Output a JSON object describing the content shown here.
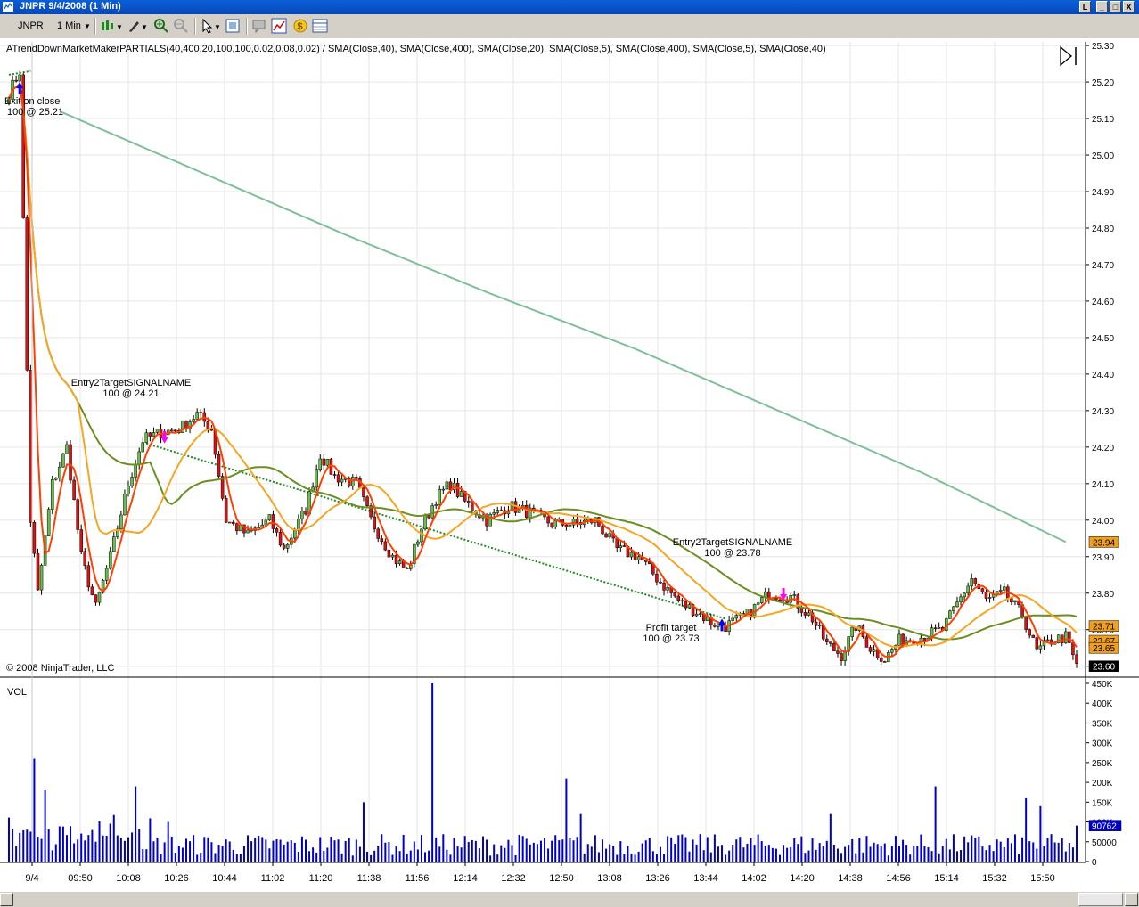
{
  "window": {
    "title": "JNPR  9/4/2008 (1 Min)",
    "buttons": [
      "L",
      "_",
      "□",
      "X"
    ]
  },
  "toolbar": {
    "instrument": "JNPR",
    "interval": "1 Min",
    "icons": [
      "candlestick-icon",
      "draw-tool-icon",
      "zoom-in-icon",
      "zoom-out-icon",
      "pointer-icon",
      "properties-icon",
      "chat-icon",
      "chart-icon",
      "dollar-icon",
      "data-box-icon"
    ]
  },
  "chart": {
    "indicator_header": "ATrendDownMarketMakerPARTIALS(40,400,20,100,100,0.02,0.08,0.02) / SMA(Close,40), SMA(Close,400), SMA(Close,20), SMA(Close,5), SMA(Close,400), SMA(Close,5), SMA(Close,40)",
    "copyright": "© 2008 NinjaTrader, LLC",
    "volume_label": "VOL",
    "price_ticks": [
      "25.30",
      "25.20",
      "25.10",
      "25.00",
      "24.90",
      "24.80",
      "24.70",
      "24.60",
      "24.50",
      "24.40",
      "24.30",
      "24.20",
      "24.10",
      "24.00",
      "23.90",
      "23.80",
      "23.70",
      "23.60"
    ],
    "volume_ticks": [
      "450K",
      "400K",
      "350K",
      "300K",
      "250K",
      "200K",
      "150K",
      "100K",
      "50000",
      "0"
    ],
    "time_ticks": [
      "9/4",
      "09:50",
      "10:08",
      "10:26",
      "10:44",
      "11:02",
      "11:20",
      "11:38",
      "11:56",
      "12:14",
      "12:32",
      "12:50",
      "13:08",
      "13:26",
      "13:44",
      "14:02",
      "14:20",
      "14:38",
      "14:56",
      "15:14",
      "15:32",
      "15:50"
    ],
    "price_flags": [
      {
        "label": "23.94",
        "value": 23.94,
        "color": "#f0a020"
      },
      {
        "label": "23.71",
        "value": 23.71,
        "color": "#f0a020"
      },
      {
        "label": "23.67",
        "value": 23.67,
        "color": "#f0a020"
      },
      {
        "label": "23.65",
        "value": 23.65,
        "color": "#f0a020"
      },
      {
        "label": "23.60",
        "value": 23.6,
        "color": "#000000"
      }
    ],
    "volume_flag": {
      "label": "90762",
      "value": 90762
    },
    "signals": [
      {
        "line1": "Exit on close",
        "line2": "100 @ 25.21",
        "arrow": "up",
        "color": "#0000ff"
      },
      {
        "line1": "Entry2TargetSIGNALNAME",
        "line2": "100 @ 24.21",
        "arrow": "down",
        "color": "#ff00ff"
      },
      {
        "line1": "Profit target",
        "line2": "100 @ 23.73",
        "arrow": "up",
        "color": "#0000ff"
      },
      {
        "line1": "Entry2TargetSIGNALNAME",
        "line2": "100 @ 23.78",
        "arrow": "down",
        "color": "#ff00ff"
      }
    ],
    "colors": {
      "up_candle": "#6abf4b",
      "down_candle": "#e01010",
      "sma5": "#ff4000",
      "sma20": "#f5a623",
      "sma40": "#6b8e23",
      "sma400": "#7fbf9a",
      "stop_dots": "#228b22",
      "volume": "#0000cc"
    }
  },
  "chart_data": {
    "type": "candlestick",
    "symbol": "JNPR",
    "interval": "1 Min",
    "date": "9/4/2008",
    "ylim": [
      23.57,
      25.31
    ],
    "volume_ylim": [
      0,
      450000
    ],
    "anchors": [
      {
        "t": 0,
        "p": 25.17
      },
      {
        "t": 3,
        "p": 25.23
      },
      {
        "t": 6,
        "p": 24.0
      },
      {
        "t": 8,
        "p": 23.8
      },
      {
        "t": 12,
        "p": 24.1
      },
      {
        "t": 16,
        "p": 24.2
      },
      {
        "t": 20,
        "p": 23.9
      },
      {
        "t": 24,
        "p": 23.76
      },
      {
        "t": 28,
        "p": 23.9
      },
      {
        "t": 33,
        "p": 24.1
      },
      {
        "t": 37,
        "p": 24.22
      },
      {
        "t": 42,
        "p": 24.24
      },
      {
        "t": 47,
        "p": 24.25
      },
      {
        "t": 52,
        "p": 24.29
      },
      {
        "t": 56,
        "p": 24.25
      },
      {
        "t": 60,
        "p": 24.0
      },
      {
        "t": 66,
        "p": 23.96
      },
      {
        "t": 72,
        "p": 24.0
      },
      {
        "t": 76,
        "p": 23.92
      },
      {
        "t": 82,
        "p": 24.03
      },
      {
        "t": 86,
        "p": 24.18
      },
      {
        "t": 90,
        "p": 24.12
      },
      {
        "t": 96,
        "p": 24.1
      },
      {
        "t": 100,
        "p": 24.0
      },
      {
        "t": 106,
        "p": 23.9
      },
      {
        "t": 110,
        "p": 23.86
      },
      {
        "t": 114,
        "p": 23.98
      },
      {
        "t": 118,
        "p": 24.06
      },
      {
        "t": 122,
        "p": 24.1
      },
      {
        "t": 126,
        "p": 24.05
      },
      {
        "t": 132,
        "p": 24.0
      },
      {
        "t": 138,
        "p": 24.04
      },
      {
        "t": 144,
        "p": 24.02
      },
      {
        "t": 150,
        "p": 23.99
      },
      {
        "t": 156,
        "p": 23.99
      },
      {
        "t": 162,
        "p": 24.0
      },
      {
        "t": 168,
        "p": 23.92
      },
      {
        "t": 174,
        "p": 23.9
      },
      {
        "t": 180,
        "p": 23.83
      },
      {
        "t": 186,
        "p": 23.77
      },
      {
        "t": 190,
        "p": 23.75
      },
      {
        "t": 194,
        "p": 23.72
      },
      {
        "t": 198,
        "p": 23.71
      },
      {
        "t": 204,
        "p": 23.74
      },
      {
        "t": 210,
        "p": 23.8
      },
      {
        "t": 216,
        "p": 23.79
      },
      {
        "t": 222,
        "p": 23.73
      },
      {
        "t": 226,
        "p": 23.66
      },
      {
        "t": 230,
        "p": 23.63
      },
      {
        "t": 234,
        "p": 23.71
      },
      {
        "t": 238,
        "p": 23.65
      },
      {
        "t": 242,
        "p": 23.62
      },
      {
        "t": 246,
        "p": 23.67
      },
      {
        "t": 252,
        "p": 23.68
      },
      {
        "t": 258,
        "p": 23.7
      },
      {
        "t": 262,
        "p": 23.77
      },
      {
        "t": 266,
        "p": 23.84
      },
      {
        "t": 270,
        "p": 23.78
      },
      {
        "t": 275,
        "p": 23.8
      },
      {
        "t": 280,
        "p": 23.74
      },
      {
        "t": 284,
        "p": 23.64
      },
      {
        "t": 288,
        "p": 23.67
      },
      {
        "t": 292,
        "p": 23.68
      },
      {
        "t": 295,
        "p": 23.6
      }
    ],
    "volume_spikes": [
      {
        "t": 7,
        "v": 260000
      },
      {
        "t": 10,
        "v": 180000
      },
      {
        "t": 35,
        "v": 190000
      },
      {
        "t": 44,
        "v": 100000
      },
      {
        "t": 98,
        "v": 150000
      },
      {
        "t": 117,
        "v": 450000
      },
      {
        "t": 154,
        "v": 210000
      },
      {
        "t": 158,
        "v": 120000
      },
      {
        "t": 227,
        "v": 120000
      },
      {
        "t": 256,
        "v": 190000
      },
      {
        "t": 281,
        "v": 160000
      },
      {
        "t": 285,
        "v": 140000
      }
    ],
    "series": [
      {
        "name": "SMA(Close,5)"
      },
      {
        "name": "SMA(Close,20)"
      },
      {
        "name": "SMA(Close,40)"
      },
      {
        "name": "SMA(Close,400)",
        "values": [
          25.12,
          24.95,
          24.78,
          24.62,
          24.47,
          24.3,
          24.13,
          23.94
        ]
      }
    ],
    "xlabel": "",
    "ylabel": ""
  }
}
